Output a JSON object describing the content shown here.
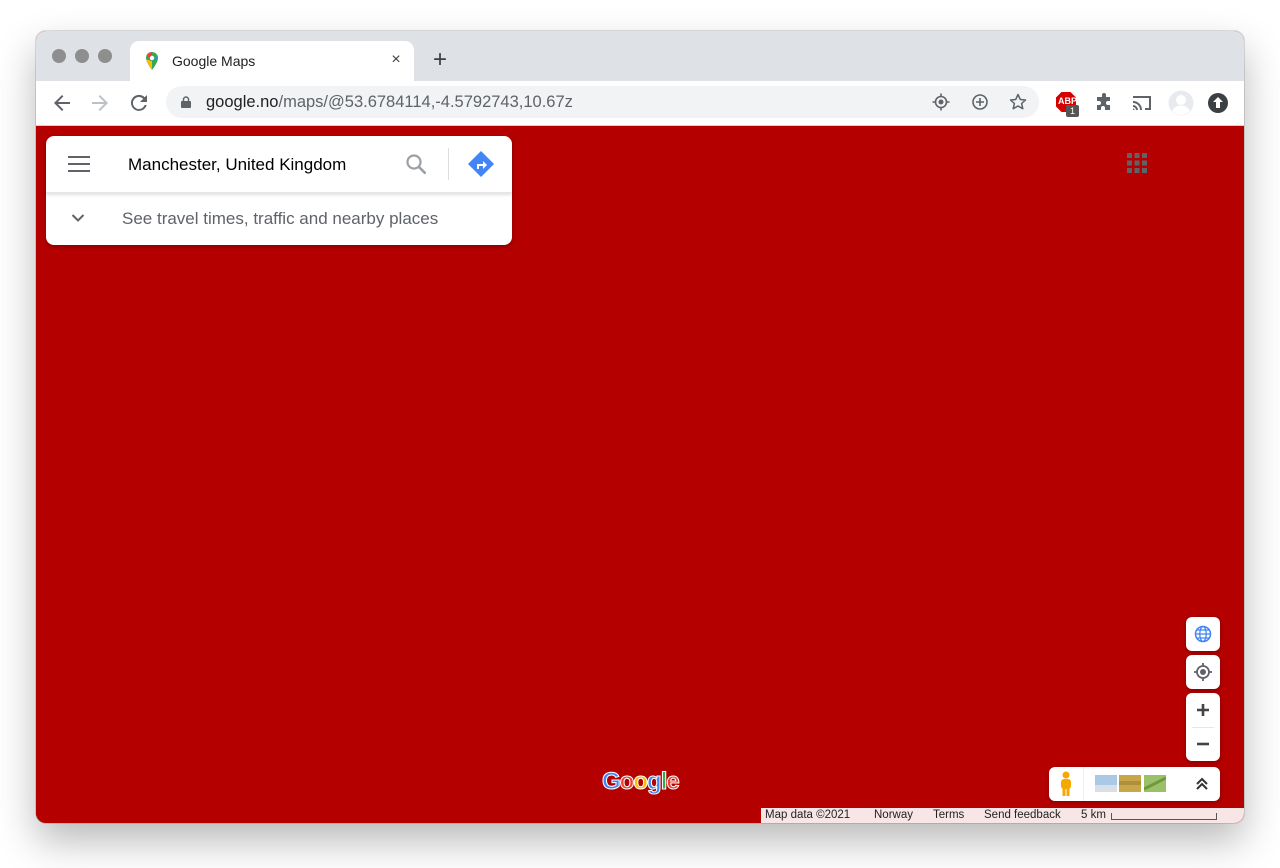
{
  "browser": {
    "tab_title": "Google Maps",
    "new_tab_label": "+",
    "close_tab_label": "×",
    "url_host": "google.no",
    "url_path": "/maps/@53.6784114,-4.5792743,10.67z",
    "abp_badge": "1",
    "adblock_label": "ABP"
  },
  "maps": {
    "search_value": "Manchester, United Kingdom",
    "hint_text": "See travel times, traffic and nearby places",
    "logo_letters": [
      "G",
      "o",
      "o",
      "g",
      "l",
      "e"
    ],
    "logo_colors": [
      "#4285f4",
      "#ea4335",
      "#fbbc05",
      "#4285f4",
      "#34a853",
      "#ea4335"
    ]
  },
  "footer": {
    "map_data": "Map data ©2021",
    "region": "Norway",
    "terms": "Terms",
    "feedback": "Send feedback",
    "scale": "5 km"
  },
  "colors": {
    "map_background": "#b50000",
    "accent_blue": "#4285f4"
  },
  "icons": {
    "menu": "hamburger-icon",
    "search": "magnifier-icon",
    "directions": "directions-icon",
    "globe": "globe-icon",
    "location": "my-location-icon",
    "zoom_in": "plus-icon",
    "zoom_out": "minus-icon",
    "pegman": "pegman-icon",
    "expand": "double-chevron-up-icon"
  }
}
